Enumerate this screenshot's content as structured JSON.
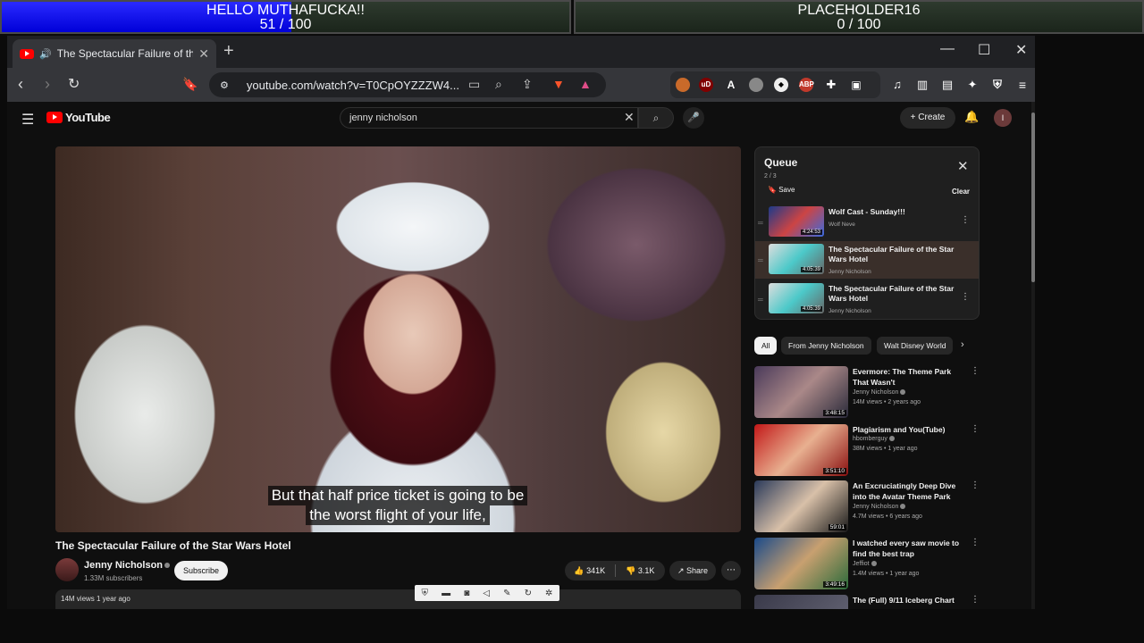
{
  "overlay": {
    "bar1": {
      "title": "HELLO MUTHAFUCKA!!",
      "count": "51 / 100",
      "progress": 0.51
    },
    "bar2": {
      "title": "PLACEHOLDER16",
      "count": "0 / 100",
      "progress": 0.0
    }
  },
  "browser": {
    "tab_title": "The Spectacular Failure of the",
    "url": "youtube.com/watch?v=T0CpOYZZZW4..."
  },
  "youtube": {
    "logo": "YouTube",
    "search_value": "jenny nicholson",
    "create_label": "Create",
    "avatar_letter": "I",
    "caption_lines": [
      "But that half price ticket is going to be",
      "the worst flight of your life,"
    ],
    "video_title": "The Spectacular Failure of the Star Wars Hotel",
    "channel_name": "Jenny Nicholson",
    "subscribers": "1.33M subscribers",
    "subscribe_label": "Subscribe",
    "likes": "341K",
    "dislikes": "3.1K",
    "share_label": "Share",
    "description_stub": "14M views  1 year ago"
  },
  "queue": {
    "title": "Queue",
    "count": "2 / 3",
    "save_label": "Save",
    "clear_label": "Clear",
    "items": [
      {
        "title": "Wolf Cast - Sunday!!!",
        "channel": "Wolf Neve",
        "duration": "4:24:53"
      },
      {
        "title": "The Spectacular Failure of the Star Wars Hotel",
        "channel": "Jenny Nicholson",
        "duration": "4:05:39"
      },
      {
        "title": "The Spectacular Failure of the Star Wars Hotel",
        "channel": "Jenny Nicholson",
        "duration": "4:05:39"
      }
    ]
  },
  "chips": [
    "All",
    "From Jenny Nicholson",
    "Walt Disney World"
  ],
  "recommendations": [
    {
      "title": "Evermore: The Theme Park That Wasn't",
      "channel": "Jenny Nicholson",
      "meta": "14M views • 2 years ago",
      "duration": "3:48:15"
    },
    {
      "title": "Plagiarism and You(Tube)",
      "channel": "hbomberguy",
      "meta": "38M views • 1 year ago",
      "duration": "3:51:10"
    },
    {
      "title": "An Excruciatingly Deep Dive into the Avatar Theme Park",
      "channel": "Jenny Nicholson",
      "meta": "4.7M views • 6 years ago",
      "duration": "59:01"
    },
    {
      "title": "I watched every saw movie to find the best trap",
      "channel": "Jeffiot",
      "meta": "1.4M views • 1 year ago",
      "duration": "3:49:16"
    },
    {
      "title": "The (Full) 9/11 Iceberg Chart",
      "channel": "",
      "meta": "",
      "duration": ""
    }
  ]
}
